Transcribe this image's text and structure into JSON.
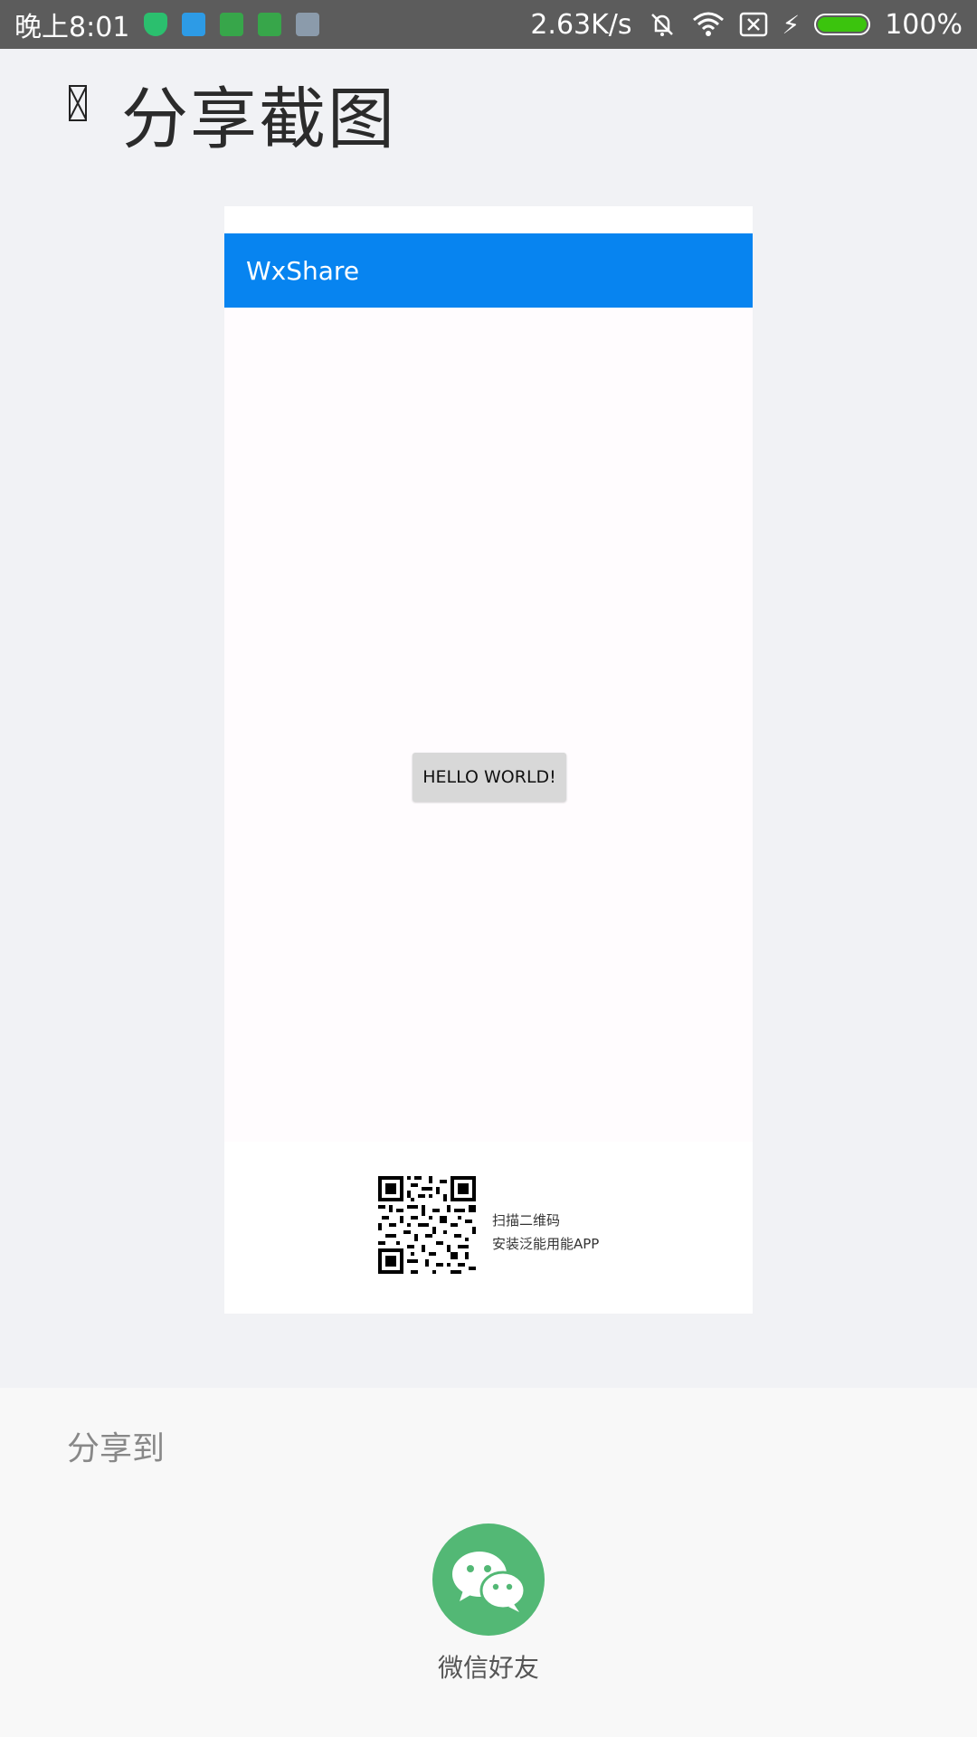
{
  "status_bar": {
    "time": "晚上8:01",
    "net_speed": "2.63K/s",
    "battery_percent": "100%",
    "battery_color": "#3bc40d",
    "icons": [
      "shield-icon",
      "doc-icon",
      "cat-icon",
      "cat-icon",
      "app-icon",
      "mute-bell-icon",
      "wifi-icon",
      "sim-error-icon",
      "charging-icon",
      "battery-icon"
    ]
  },
  "header": {
    "title": "分享截图",
    "back_icon": "back-icon"
  },
  "preview": {
    "app_title": "WxShare",
    "app_bar_color": "#0784f0",
    "button_label": "HELLO WORLD!",
    "qr_line1": "扫描二维码",
    "qr_line2": "安装泛能用能APP"
  },
  "share_sheet": {
    "title": "分享到",
    "targets": [
      {
        "label": "微信好友",
        "icon": "wechat-icon",
        "color": "#53b875"
      }
    ]
  }
}
